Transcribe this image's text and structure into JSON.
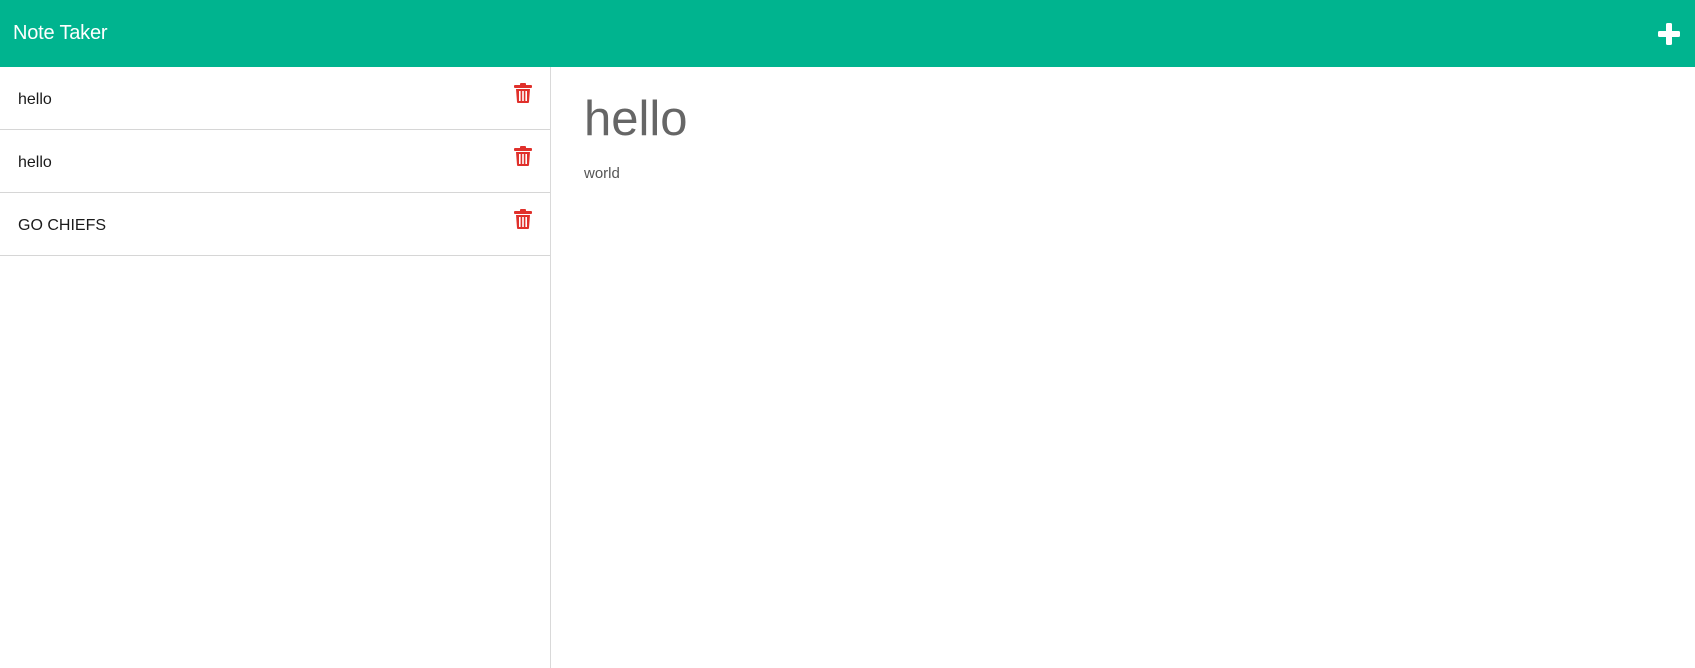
{
  "navbar": {
    "brand": "Note Taker",
    "new_note_icon": "plus-icon",
    "bg_color": "#00b48f"
  },
  "sidebar": {
    "notes": [
      {
        "title": "hello",
        "delete_icon": "trash-icon"
      },
      {
        "title": "hello",
        "delete_icon": "trash-icon"
      },
      {
        "title": "GO CHIEFS",
        "delete_icon": "trash-icon"
      }
    ],
    "delete_color": "#e0302b"
  },
  "main": {
    "title": "hello",
    "text": "world"
  }
}
